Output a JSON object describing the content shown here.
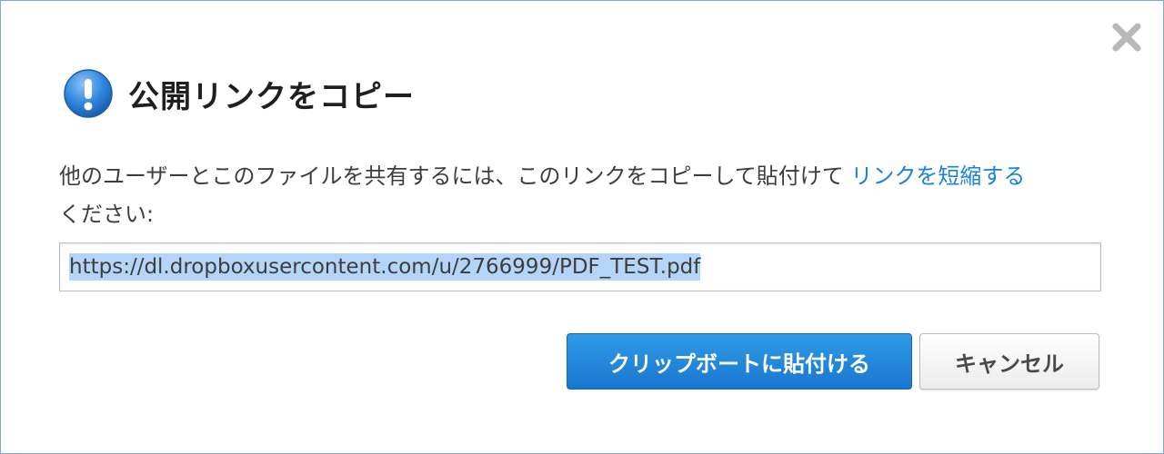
{
  "dialog": {
    "title": "公開リンクをコピー",
    "message": "他のユーザーとこのファイルを共有するには、このリンクをコピーして貼付けて ",
    "shorten_link": "リンクを短縮する",
    "message_end": "ください:",
    "url": "https://dl.dropboxusercontent.com/u/2766999/PDF_TEST.pdf",
    "buttons": {
      "copy": "クリップボートに貼付ける",
      "cancel": "キャンセル"
    },
    "icons": {
      "title_icon": "info-exclamation-icon",
      "close_icon": "close-icon"
    }
  },
  "colors": {
    "accent": "#1a82d8",
    "primary_button": "#1f86dc",
    "selection": "#b5d5f8"
  }
}
